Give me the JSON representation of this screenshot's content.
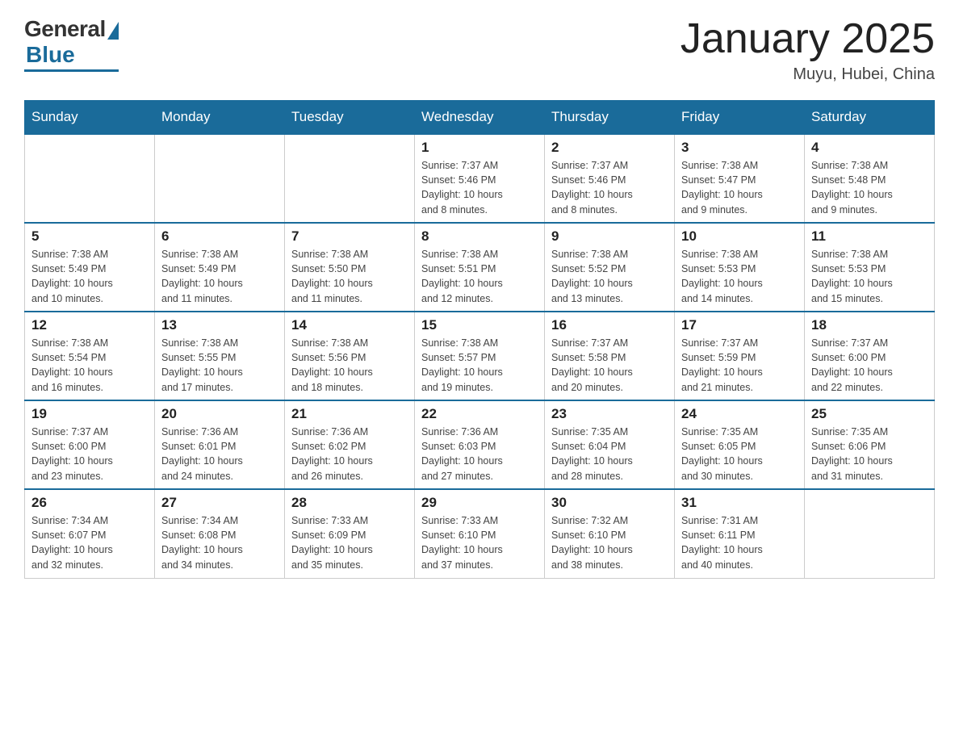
{
  "logo": {
    "general": "General",
    "blue": "Blue"
  },
  "header": {
    "title": "January 2025",
    "location": "Muyu, Hubei, China"
  },
  "weekdays": [
    "Sunday",
    "Monday",
    "Tuesday",
    "Wednesday",
    "Thursday",
    "Friday",
    "Saturday"
  ],
  "weeks": [
    [
      {
        "day": "",
        "info": ""
      },
      {
        "day": "",
        "info": ""
      },
      {
        "day": "",
        "info": ""
      },
      {
        "day": "1",
        "info": "Sunrise: 7:37 AM\nSunset: 5:46 PM\nDaylight: 10 hours\nand 8 minutes."
      },
      {
        "day": "2",
        "info": "Sunrise: 7:37 AM\nSunset: 5:46 PM\nDaylight: 10 hours\nand 8 minutes."
      },
      {
        "day": "3",
        "info": "Sunrise: 7:38 AM\nSunset: 5:47 PM\nDaylight: 10 hours\nand 9 minutes."
      },
      {
        "day": "4",
        "info": "Sunrise: 7:38 AM\nSunset: 5:48 PM\nDaylight: 10 hours\nand 9 minutes."
      }
    ],
    [
      {
        "day": "5",
        "info": "Sunrise: 7:38 AM\nSunset: 5:49 PM\nDaylight: 10 hours\nand 10 minutes."
      },
      {
        "day": "6",
        "info": "Sunrise: 7:38 AM\nSunset: 5:49 PM\nDaylight: 10 hours\nand 11 minutes."
      },
      {
        "day": "7",
        "info": "Sunrise: 7:38 AM\nSunset: 5:50 PM\nDaylight: 10 hours\nand 11 minutes."
      },
      {
        "day": "8",
        "info": "Sunrise: 7:38 AM\nSunset: 5:51 PM\nDaylight: 10 hours\nand 12 minutes."
      },
      {
        "day": "9",
        "info": "Sunrise: 7:38 AM\nSunset: 5:52 PM\nDaylight: 10 hours\nand 13 minutes."
      },
      {
        "day": "10",
        "info": "Sunrise: 7:38 AM\nSunset: 5:53 PM\nDaylight: 10 hours\nand 14 minutes."
      },
      {
        "day": "11",
        "info": "Sunrise: 7:38 AM\nSunset: 5:53 PM\nDaylight: 10 hours\nand 15 minutes."
      }
    ],
    [
      {
        "day": "12",
        "info": "Sunrise: 7:38 AM\nSunset: 5:54 PM\nDaylight: 10 hours\nand 16 minutes."
      },
      {
        "day": "13",
        "info": "Sunrise: 7:38 AM\nSunset: 5:55 PM\nDaylight: 10 hours\nand 17 minutes."
      },
      {
        "day": "14",
        "info": "Sunrise: 7:38 AM\nSunset: 5:56 PM\nDaylight: 10 hours\nand 18 minutes."
      },
      {
        "day": "15",
        "info": "Sunrise: 7:38 AM\nSunset: 5:57 PM\nDaylight: 10 hours\nand 19 minutes."
      },
      {
        "day": "16",
        "info": "Sunrise: 7:37 AM\nSunset: 5:58 PM\nDaylight: 10 hours\nand 20 minutes."
      },
      {
        "day": "17",
        "info": "Sunrise: 7:37 AM\nSunset: 5:59 PM\nDaylight: 10 hours\nand 21 minutes."
      },
      {
        "day": "18",
        "info": "Sunrise: 7:37 AM\nSunset: 6:00 PM\nDaylight: 10 hours\nand 22 minutes."
      }
    ],
    [
      {
        "day": "19",
        "info": "Sunrise: 7:37 AM\nSunset: 6:00 PM\nDaylight: 10 hours\nand 23 minutes."
      },
      {
        "day": "20",
        "info": "Sunrise: 7:36 AM\nSunset: 6:01 PM\nDaylight: 10 hours\nand 24 minutes."
      },
      {
        "day": "21",
        "info": "Sunrise: 7:36 AM\nSunset: 6:02 PM\nDaylight: 10 hours\nand 26 minutes."
      },
      {
        "day": "22",
        "info": "Sunrise: 7:36 AM\nSunset: 6:03 PM\nDaylight: 10 hours\nand 27 minutes."
      },
      {
        "day": "23",
        "info": "Sunrise: 7:35 AM\nSunset: 6:04 PM\nDaylight: 10 hours\nand 28 minutes."
      },
      {
        "day": "24",
        "info": "Sunrise: 7:35 AM\nSunset: 6:05 PM\nDaylight: 10 hours\nand 30 minutes."
      },
      {
        "day": "25",
        "info": "Sunrise: 7:35 AM\nSunset: 6:06 PM\nDaylight: 10 hours\nand 31 minutes."
      }
    ],
    [
      {
        "day": "26",
        "info": "Sunrise: 7:34 AM\nSunset: 6:07 PM\nDaylight: 10 hours\nand 32 minutes."
      },
      {
        "day": "27",
        "info": "Sunrise: 7:34 AM\nSunset: 6:08 PM\nDaylight: 10 hours\nand 34 minutes."
      },
      {
        "day": "28",
        "info": "Sunrise: 7:33 AM\nSunset: 6:09 PM\nDaylight: 10 hours\nand 35 minutes."
      },
      {
        "day": "29",
        "info": "Sunrise: 7:33 AM\nSunset: 6:10 PM\nDaylight: 10 hours\nand 37 minutes."
      },
      {
        "day": "30",
        "info": "Sunrise: 7:32 AM\nSunset: 6:10 PM\nDaylight: 10 hours\nand 38 minutes."
      },
      {
        "day": "31",
        "info": "Sunrise: 7:31 AM\nSunset: 6:11 PM\nDaylight: 10 hours\nand 40 minutes."
      },
      {
        "day": "",
        "info": ""
      }
    ]
  ]
}
